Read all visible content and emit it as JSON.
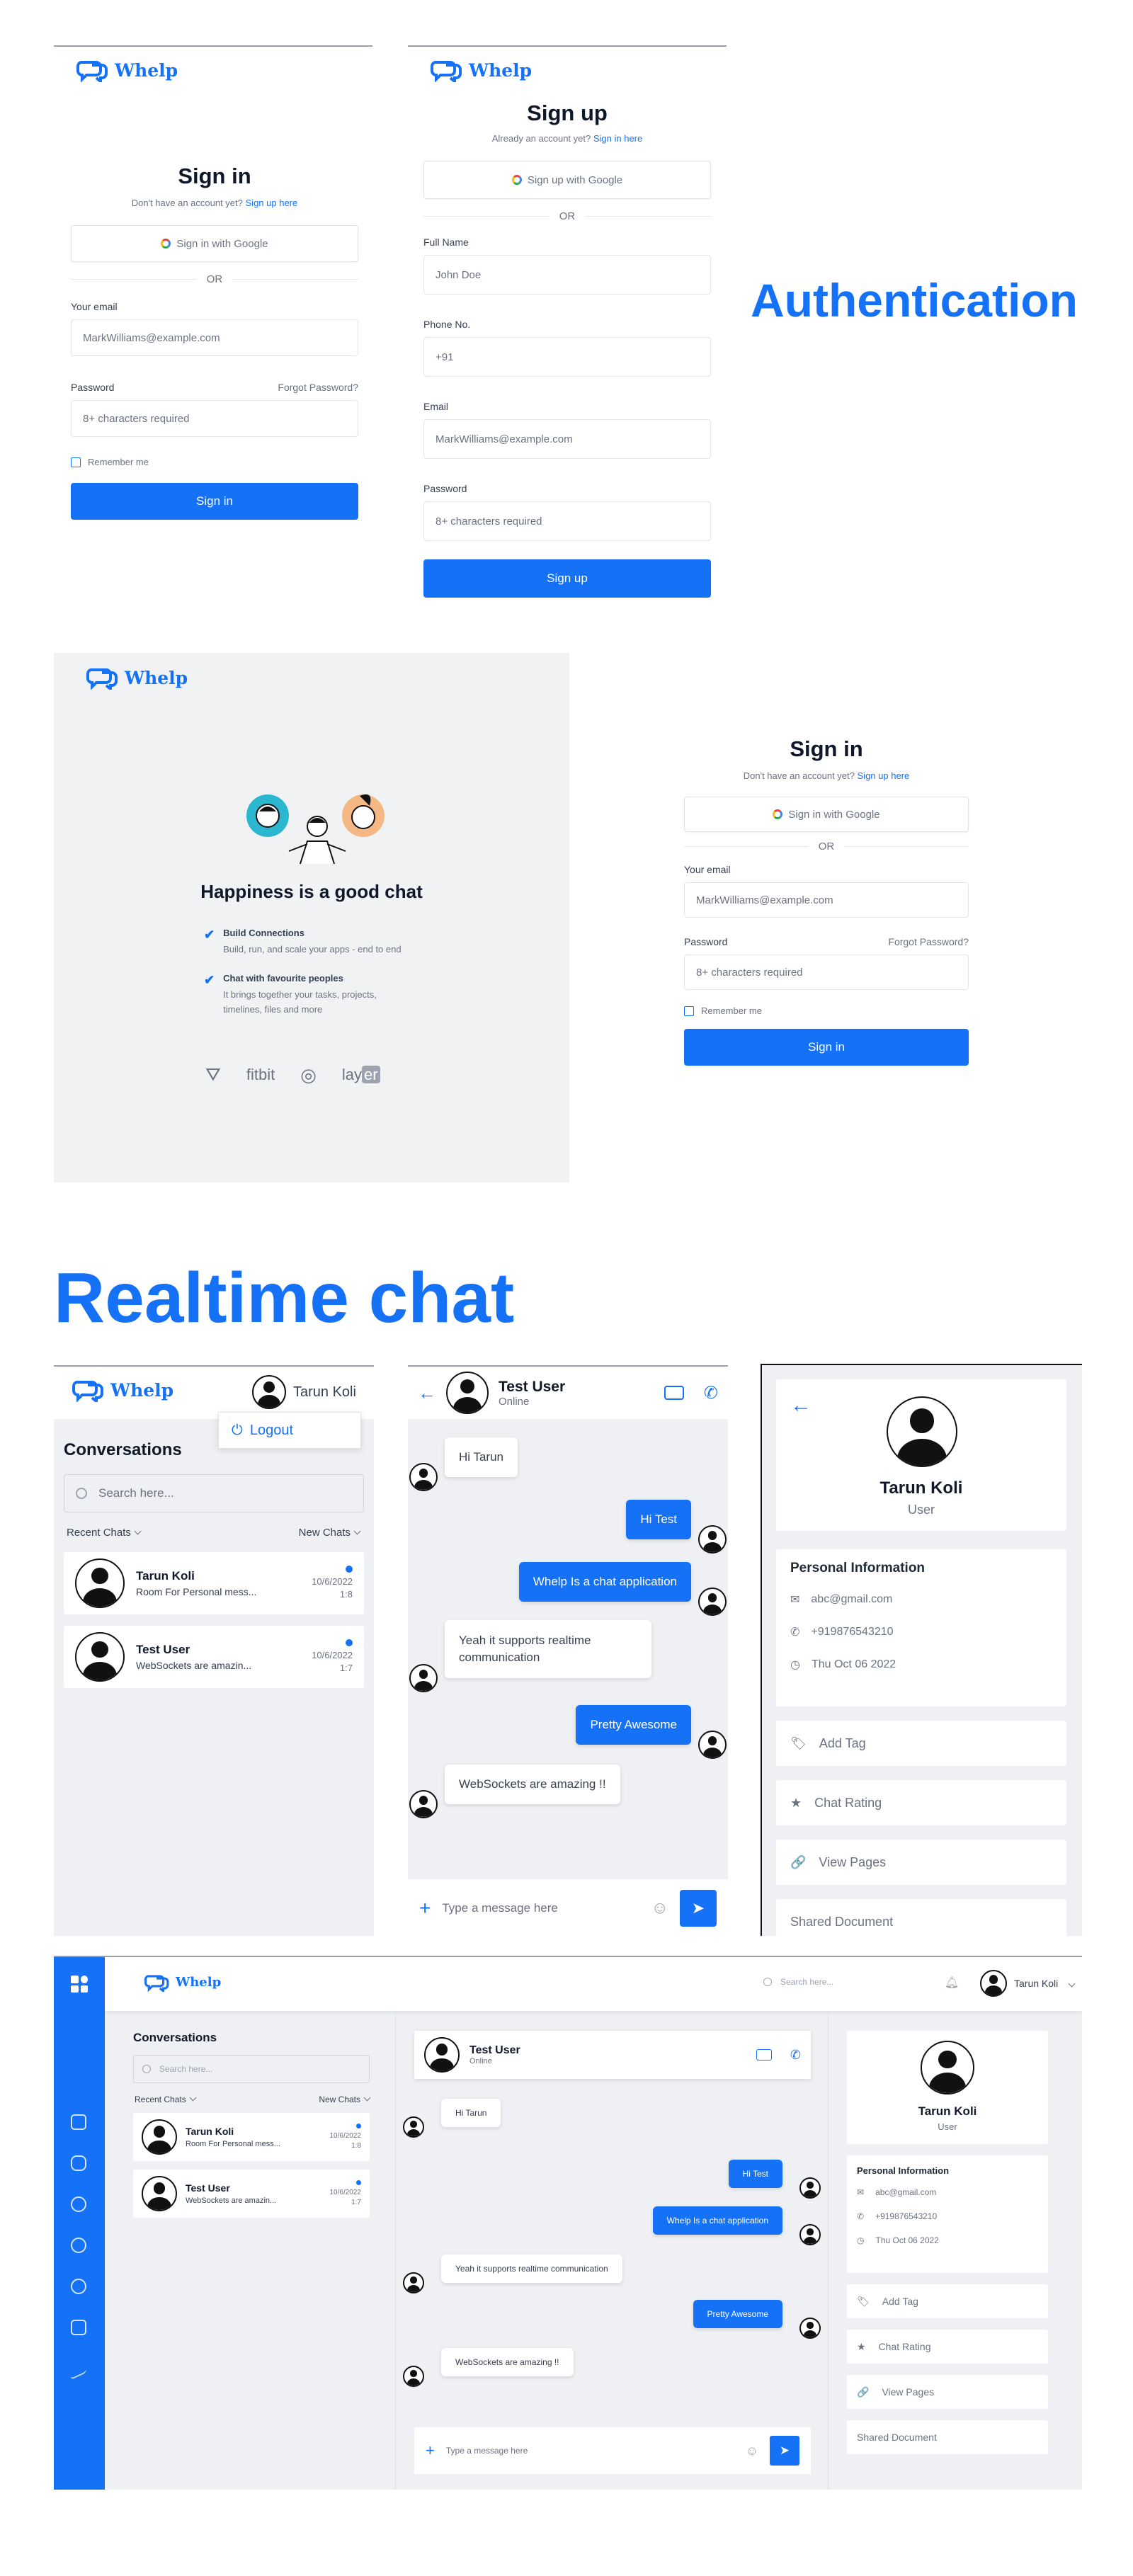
{
  "brand": {
    "name": "Whelp",
    "accent": "#1572f6"
  },
  "section_titles": {
    "auth": "Authentication",
    "chat": "Realtime chat"
  },
  "signin": {
    "title": "Sign in",
    "prompt": "Don't have an account yet?",
    "prompt_link": "Sign up here",
    "google": "Sign in with Google",
    "or": "OR",
    "email_label": "Your email",
    "email_placeholder": "MarkWilliams@example.com",
    "password_label": "Password",
    "forgot": "Forgot Password?",
    "password_placeholder": "8+ characters required",
    "remember": "Remember me",
    "submit": "Sign in"
  },
  "signup": {
    "title": "Sign up",
    "prompt": "Already an account yet?",
    "prompt_link": "Sign in here",
    "google": "Sign up with Google",
    "or": "OR",
    "name_label": "Full Name",
    "name_placeholder": "John Doe",
    "phone_label": "Phone No.",
    "phone_placeholder": "+91",
    "email_label": "Email",
    "email_placeholder": "MarkWilliams@example.com",
    "password_label": "Password",
    "password_placeholder": "8+ characters required",
    "submit": "Sign up"
  },
  "promo": {
    "headline": "Happiness is a good chat",
    "features": [
      {
        "title": "Build Connections",
        "text": "Build, run, and scale your apps - end to end"
      },
      {
        "title": "Chat with favourite peoples",
        "text": "It brings together your tasks, projects, timelines, files and more"
      }
    ],
    "logos": [
      "fitbit",
      "lay",
      "er"
    ]
  },
  "user": {
    "name": "Tarun Koli",
    "role": "User",
    "logout": "Logout"
  },
  "conversations": {
    "title": "Conversations",
    "search_placeholder": "Search here...",
    "recent": "Recent Chats",
    "new": "New Chats",
    "items": [
      {
        "name": "Tarun Koli",
        "preview": "Room For Personal mess...",
        "date": "10/6/2022",
        "time": "1:8"
      },
      {
        "name": "Test User",
        "preview": "WebSockets are amazin...",
        "date": "10/6/2022",
        "time": "1:7"
      }
    ]
  },
  "chat": {
    "contact": "Test User",
    "status": "Online",
    "messages": [
      {
        "text": "Hi Tarun",
        "dir": "in"
      },
      {
        "text": "Hi Test",
        "dir": "out"
      },
      {
        "text": "Whelp Is a chat application",
        "dir": "out"
      },
      {
        "text": "Yeah it supports realtime communication",
        "dir": "in"
      },
      {
        "text": "Pretty Awesome",
        "dir": "out"
      },
      {
        "text": "WebSockets are amazing !!",
        "dir": "in"
      }
    ],
    "input_placeholder": "Type a message here"
  },
  "profile": {
    "info_title": "Personal Information",
    "email": "abc@gmail.com",
    "phone": "+919876543210",
    "date": "Thu Oct 06 2022",
    "actions": [
      "Add Tag",
      "Chat Rating",
      "View Pages",
      "Shared Document"
    ]
  },
  "desktop": {
    "search_placeholder": "Search here..."
  }
}
